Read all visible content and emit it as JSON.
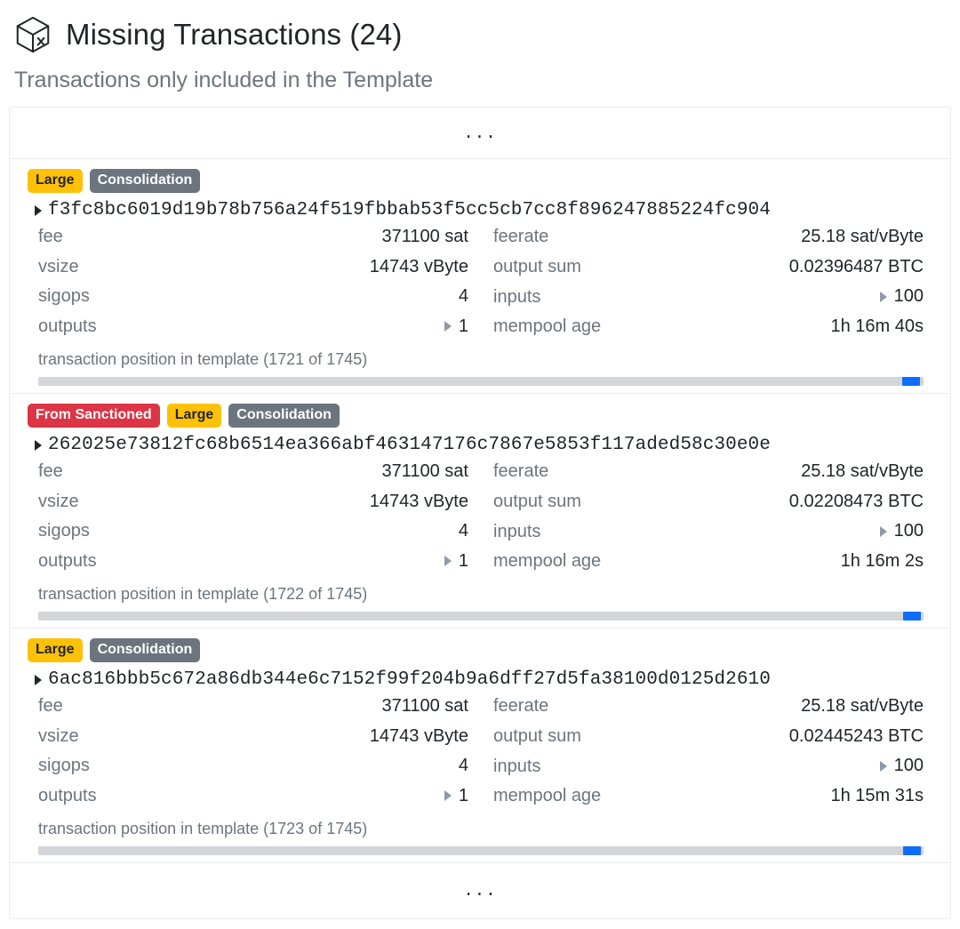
{
  "header": {
    "icon": "block-missing-icon",
    "title": "Missing Transactions (24)",
    "subtitle": "Transactions only included in the Template"
  },
  "list": {
    "top_ellipsis": "...",
    "bottom_ellipsis": "...",
    "position_bar_total": 1745
  },
  "colors": {
    "accent_blue": "#0d6efd",
    "badge_large": "#ffc107",
    "badge_consolidation": "#6c757d",
    "badge_sanctioned": "#dc3545",
    "muted_text": "#6c757d",
    "track": "#d3d5d8",
    "border": "#e9ecef"
  },
  "labels": {
    "fee": "fee",
    "vsize": "vsize",
    "sigops": "sigops",
    "outputs": "outputs",
    "feerate": "feerate",
    "output_sum": "output sum",
    "inputs": "inputs",
    "mempool_age": "mempool age"
  },
  "transactions": [
    {
      "badges": [
        {
          "label": "Large",
          "kind": "large"
        },
        {
          "label": "Consolidation",
          "kind": "consolidation"
        }
      ],
      "txid": "f3fc8bc6019d19b78b756a24f519fbbab53f5cc5cb7cc8f896247885224fc904",
      "fee": "371100 sat",
      "vsize": "14743 vByte",
      "sigops": "4",
      "outputs": "1",
      "feerate": "25.18 sat/vByte",
      "output_sum": "0.02396487 BTC",
      "inputs": "100",
      "mempool_age": "1h 16m 40s",
      "position_text": "transaction position in template (1721 of 1745)",
      "position_index": 1721,
      "position_total": 1745,
      "progress_percent": 98.6
    },
    {
      "badges": [
        {
          "label": "From Sanctioned",
          "kind": "sanctioned"
        },
        {
          "label": "Large",
          "kind": "large"
        },
        {
          "label": "Consolidation",
          "kind": "consolidation"
        }
      ],
      "txid": "262025e73812fc68b6514ea366abf463147176c7867e5853f117aded58c30e0e",
      "fee": "371100 sat",
      "vsize": "14743 vByte",
      "sigops": "4",
      "outputs": "1",
      "feerate": "25.18 sat/vByte",
      "output_sum": "0.02208473 BTC",
      "inputs": "100",
      "mempool_age": "1h 16m 2s",
      "position_text": "transaction position in template (1722 of 1745)",
      "position_index": 1722,
      "position_total": 1745,
      "progress_percent": 98.7
    },
    {
      "badges": [
        {
          "label": "Large",
          "kind": "large"
        },
        {
          "label": "Consolidation",
          "kind": "consolidation"
        }
      ],
      "txid": "6ac816bbb5c672a86db344e6c7152f99f204b9a6dff27d5fa38100d0125d2610",
      "fee": "371100 sat",
      "vsize": "14743 vByte",
      "sigops": "4",
      "outputs": "1",
      "feerate": "25.18 sat/vByte",
      "output_sum": "0.02445243 BTC",
      "inputs": "100",
      "mempool_age": "1h 15m 31s",
      "position_text": "transaction position in template (1723 of 1745)",
      "position_index": 1723,
      "position_total": 1745,
      "progress_percent": 98.7
    }
  ]
}
